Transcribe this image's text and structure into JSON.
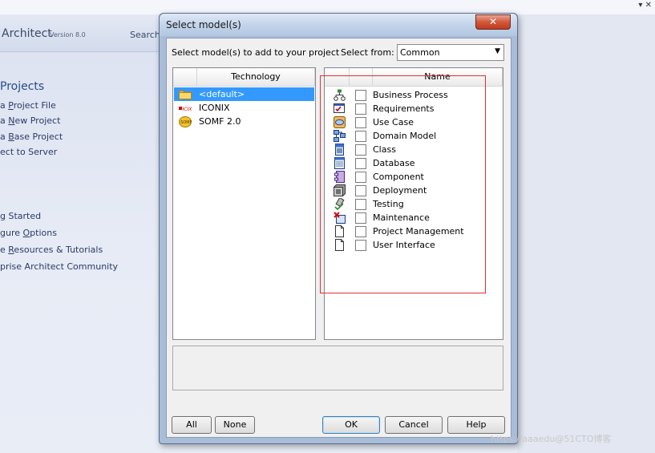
{
  "background": {
    "top_icons": "▾ ✕",
    "app_title": "Architect",
    "version": "Version 8.0",
    "search_label": "Search",
    "projects_heading": "Projects",
    "links": [
      {
        "pre": "a ",
        "ul": "P",
        "post": "roject File"
      },
      {
        "pre": "a ",
        "ul": "N",
        "post": "ew Project"
      },
      {
        "pre": "a ",
        "ul": "B",
        "post": "ase Project"
      },
      {
        "pre": "ect to Server",
        "ul": "",
        "post": ""
      },
      {
        "pre": "g Started",
        "ul": "",
        "post": ""
      },
      {
        "pre": "gure ",
        "ul": "O",
        "post": "ptions"
      },
      {
        "pre": "e ",
        "ul": "R",
        "post": "esources & Tutorials"
      },
      {
        "pre": "prise Architect Community",
        "ul": "",
        "post": ""
      }
    ]
  },
  "dialog": {
    "title": "Select model(s)",
    "close_glyph": "✕",
    "prompt": "Select model(s) to add to your project",
    "select_from_label": "Select from:",
    "select_from_value": "Common",
    "technology_header": "Technology",
    "name_header": "Name",
    "technologies": [
      {
        "label": "<default>",
        "icon": "folder-icon",
        "selected": true
      },
      {
        "label": "ICONIX",
        "icon": "iconix-logo-icon",
        "selected": false
      },
      {
        "label": "SOMF 2.0",
        "icon": "somf-logo-icon",
        "selected": false
      }
    ],
    "models": [
      {
        "label": "Business Process",
        "icon": "business-process-icon",
        "checked": false
      },
      {
        "label": "Requirements",
        "icon": "requirements-icon",
        "checked": false
      },
      {
        "label": "Use Case",
        "icon": "use-case-icon",
        "checked": false
      },
      {
        "label": "Domain Model",
        "icon": "domain-model-icon",
        "checked": false
      },
      {
        "label": "Class",
        "icon": "class-icon",
        "checked": false
      },
      {
        "label": "Database",
        "icon": "database-icon",
        "checked": false
      },
      {
        "label": "Component",
        "icon": "component-icon",
        "checked": false
      },
      {
        "label": "Deployment",
        "icon": "deployment-icon",
        "checked": false
      },
      {
        "label": "Testing",
        "icon": "testing-icon",
        "checked": false
      },
      {
        "label": "Maintenance",
        "icon": "maintenance-icon",
        "checked": false
      },
      {
        "label": "Project Management",
        "icon": "project-management-icon",
        "checked": false
      },
      {
        "label": "User Interface",
        "icon": "user-interface-icon",
        "checked": false
      }
    ],
    "buttons": {
      "all": "All",
      "none": "None",
      "ok": "OK",
      "cancel": "Cancel",
      "help": "Help"
    }
  },
  "watermark": "https://aaaedu@51CTO博客",
  "colors": {
    "selection": "#3399ff",
    "highlight_box": "#e03030",
    "close_button": "#c03a1e"
  }
}
